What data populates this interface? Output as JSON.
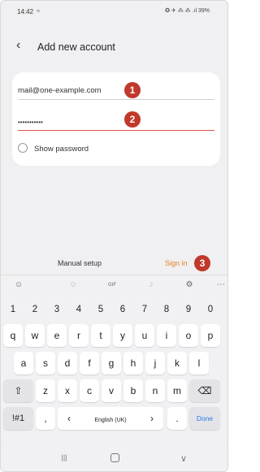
{
  "status": {
    "time": "14:42",
    "left_icon": "≈",
    "right_icons": "✪ ✈ ⁂ ⁂ .ıl 39%"
  },
  "header": {
    "title": "Add new account"
  },
  "form": {
    "email_value": "mail@one-example.com",
    "password_value": "•••••••••••",
    "show_password_label": "Show password"
  },
  "callouts": {
    "email": "1",
    "password": "2",
    "sign_in": "3"
  },
  "actions": {
    "manual_setup": "Manual setup",
    "sign_in": "Sign in"
  },
  "keyboard": {
    "toolbar": {
      "emoji": "☺",
      "sticker": "☺",
      "gif": "GIF",
      "mic": "♪",
      "settings": "⚙",
      "more": "⋯"
    },
    "numbers": [
      "1",
      "2",
      "3",
      "4",
      "5",
      "6",
      "7",
      "8",
      "9",
      "0"
    ],
    "row1": [
      "q",
      "w",
      "e",
      "r",
      "t",
      "y",
      "u",
      "i",
      "o",
      "p"
    ],
    "row2": [
      "a",
      "s",
      "d",
      "f",
      "g",
      "h",
      "j",
      "k",
      "l"
    ],
    "row3": [
      "z",
      "x",
      "c",
      "v",
      "b",
      "n",
      "m"
    ],
    "shift": "⇧",
    "backspace": "⌫",
    "symbols": "!#1",
    "comma": ",",
    "left_arrow": "‹",
    "space": "English (UK)",
    "right_arrow": "›",
    "period": ".",
    "done": "Done"
  },
  "navbar": {
    "recent": "|||",
    "home": "",
    "back": "∨"
  },
  "colors": {
    "accent": "#e67e22",
    "callout": "#c0392b",
    "done": "#2f7be6"
  }
}
